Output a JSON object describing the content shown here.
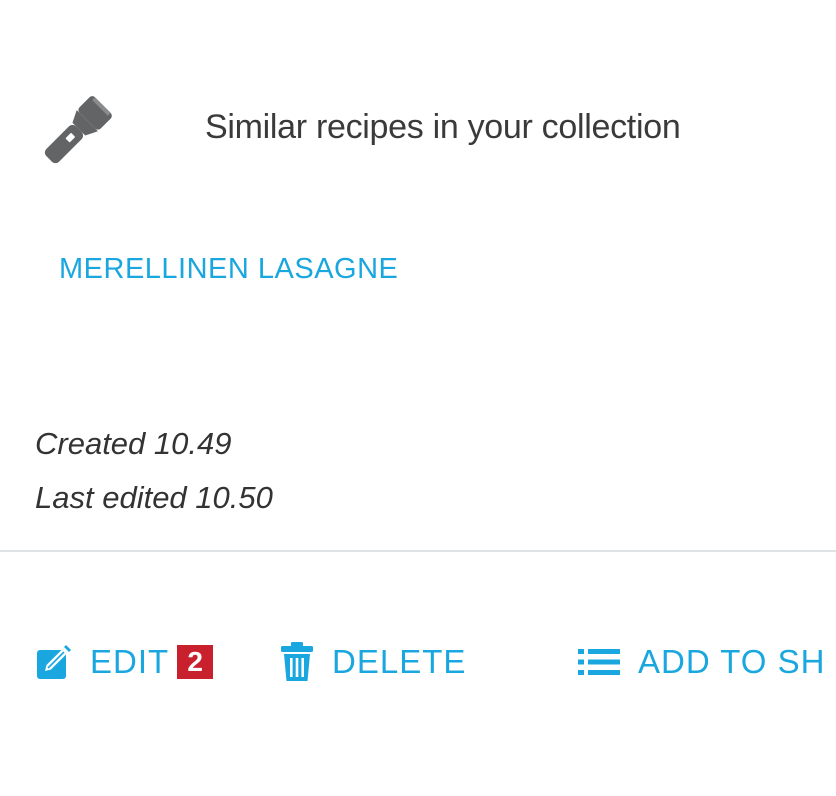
{
  "similar": {
    "icon": "flashlight-icon",
    "title": "Similar recipes in your collection"
  },
  "recipe": {
    "link_label": "MERELLINEN LASAGNE"
  },
  "meta": {
    "created": "Created 10.49",
    "last_edited": "Last edited 10.50"
  },
  "actions": {
    "edit_label": "EDIT",
    "edit_icon": "edit-icon",
    "badge": "2",
    "delete_label": "DELETE",
    "delete_icon": "trash-icon",
    "shop_label": "ADD TO SH",
    "shop_icon": "list-icon"
  },
  "colors": {
    "accent": "#1aa7df",
    "badge": "#c8202c",
    "icon_gray": "#636466",
    "text": "#333333"
  }
}
